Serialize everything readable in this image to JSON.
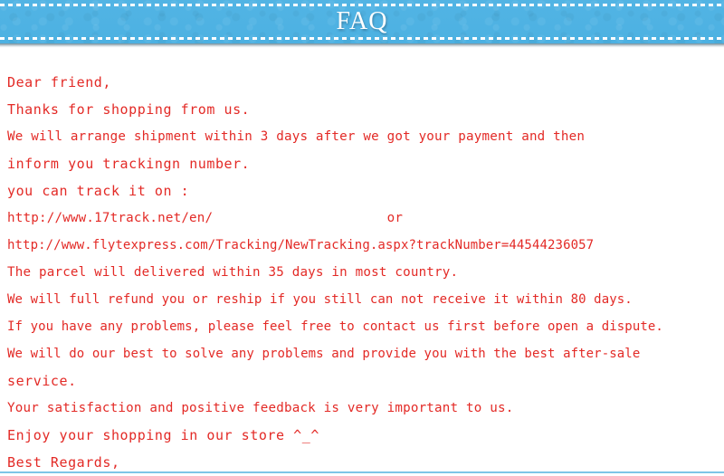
{
  "header": {
    "title": "FAQ",
    "banner_color": "#4fb3e3",
    "dash_color": "#ffffff",
    "title_color": "#ffffff"
  },
  "body": {
    "text_color": "#e32a26",
    "lines": [
      "Dear friend,",
      "Thanks for shopping from us.",
      "We will arrange shipment within 3 days after we got your payment and then",
      "inform you trackingn number.",
      "you can track it on :",
      "http://www.17track.net/en/                      or",
      "http://www.flytexpress.com/Tracking/NewTracking.aspx?trackNumber=44544236057",
      "The parcel will delivered within 35 days in most country.",
      "We will full refund you or reship if you still can not receive it within 80 days.",
      "If you have any problems, please feel free to contact us first before open a dispute.",
      "We will do our best to solve any problems and provide you with the best after-sale",
      "service.",
      "Your satisfaction and positive feedback is very important to us.",
      "Enjoy your shopping in our store ^_^",
      "Best Regards,"
    ]
  },
  "footer": {
    "rule_color": "#7ec5e6"
  }
}
